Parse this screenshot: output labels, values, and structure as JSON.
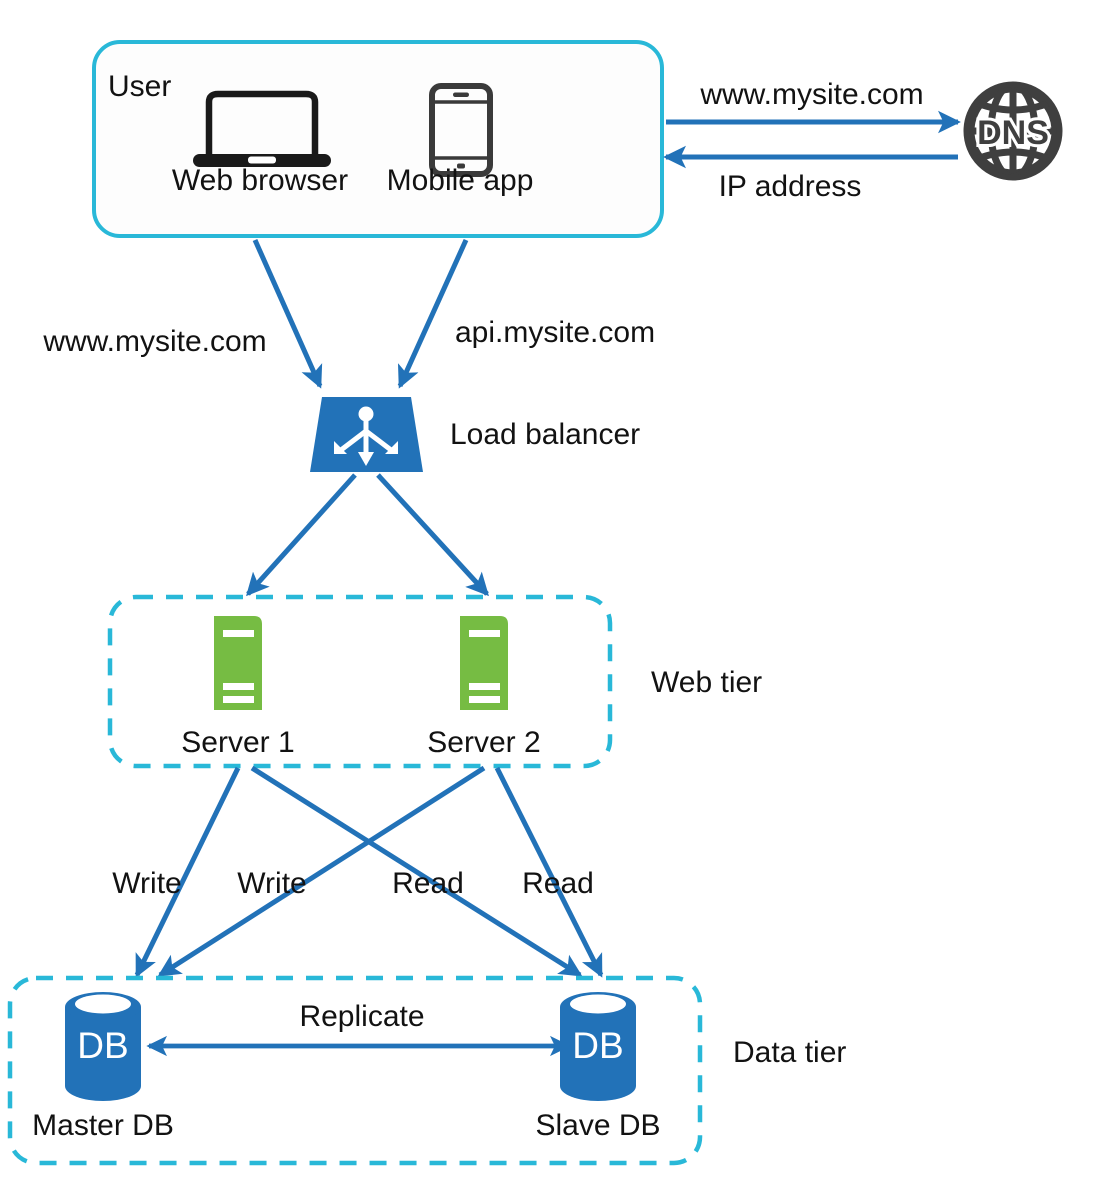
{
  "diagram": {
    "title": "Web system architecture with DNS, load balancer, web tier and data tier",
    "colors": {
      "arrow_blue": "#2272b8",
      "node_blue": "#2272b8",
      "tier_cyan": "#29b8d8",
      "user_border_cyan": "#29b8d8",
      "server_green": "#76bc43",
      "dns_gray": "#3f3f3f",
      "icon_black": "#1a1a1a",
      "text_black": "#121212",
      "background": "#ffffff"
    },
    "groups": [
      {
        "id": "user",
        "label": "User",
        "style": "solid-rounded-cyan"
      },
      {
        "id": "web-tier",
        "label": "Web tier",
        "style": "dashed-rounded-cyan"
      },
      {
        "id": "data-tier",
        "label": "Data tier",
        "style": "dashed-rounded-cyan"
      }
    ],
    "nodes": [
      {
        "id": "web-browser",
        "label": "Web browser",
        "icon": "laptop-icon"
      },
      {
        "id": "mobile-app",
        "label": "Mobile app",
        "icon": "mobile-phone-icon"
      },
      {
        "id": "dns",
        "label": "DNS",
        "icon": "globe-icon"
      },
      {
        "id": "load-balancer",
        "label": "Load balancer",
        "icon": "load-balancer-icon"
      },
      {
        "id": "server-1",
        "label": "Server 1",
        "icon": "server-icon"
      },
      {
        "id": "server-2",
        "label": "Server 2",
        "icon": "server-icon"
      },
      {
        "id": "master-db",
        "label": "Master DB",
        "icon": "database-cylinder-icon",
        "badge": "DB"
      },
      {
        "id": "slave-db",
        "label": "Slave DB",
        "icon": "database-cylinder-icon",
        "badge": "DB"
      }
    ],
    "edges": [
      {
        "id": "user-to-dns",
        "label": "www.mysite.com",
        "from": "user",
        "to": "dns"
      },
      {
        "id": "dns-to-user",
        "label": "IP address",
        "from": "dns",
        "to": "user"
      },
      {
        "id": "browser-to-lb",
        "label": "www.mysite.com",
        "from": "web-browser",
        "to": "load-balancer"
      },
      {
        "id": "mobile-to-lb",
        "label": "api.mysite.com",
        "from": "mobile-app",
        "to": "load-balancer"
      },
      {
        "id": "lb-to-server1",
        "label": "",
        "from": "load-balancer",
        "to": "server-1"
      },
      {
        "id": "lb-to-server2",
        "label": "",
        "from": "load-balancer",
        "to": "server-2"
      },
      {
        "id": "server1-write",
        "label": "Write",
        "from": "server-1",
        "to": "master-db"
      },
      {
        "id": "server2-write",
        "label": "Write",
        "from": "server-2",
        "to": "master-db"
      },
      {
        "id": "server1-read",
        "label": "Read",
        "from": "server-1",
        "to": "slave-db"
      },
      {
        "id": "server2-read",
        "label": "Read",
        "from": "server-2",
        "to": "slave-db"
      },
      {
        "id": "replicate",
        "label": "Replicate",
        "from": "master-db",
        "to": "slave-db"
      }
    ],
    "labels": {
      "user": "User",
      "web_browser": "Web browser",
      "mobile_app": "Mobile app",
      "dns": "DNS",
      "url_www": "www.mysite.com",
      "ip_address": "IP address",
      "url_www_2": "www.mysite.com",
      "url_api": "api.mysite.com",
      "load_balancer": "Load balancer",
      "server_1": "Server 1",
      "server_2": "Server 2",
      "web_tier": "Web tier",
      "write_1": "Write",
      "write_2": "Write",
      "read_1": "Read",
      "read_2": "Read",
      "master_db": "Master DB",
      "slave_db": "Slave DB",
      "db_badge_master": "DB",
      "db_badge_slave": "DB",
      "replicate": "Replicate",
      "data_tier": "Data tier"
    }
  }
}
